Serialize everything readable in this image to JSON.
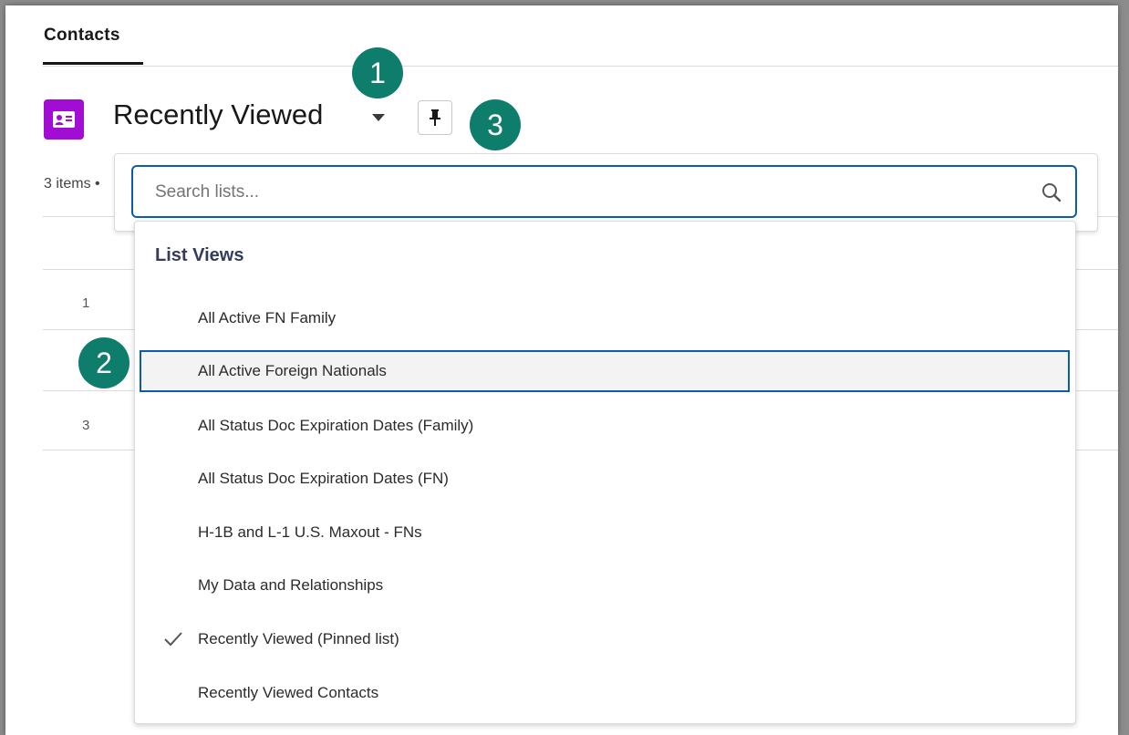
{
  "tab": {
    "title": "Contacts"
  },
  "header": {
    "list_title": "Recently Viewed",
    "object_icon": "contact-card-icon",
    "caret_icon": "caret-down-icon",
    "pin_icon": "pin-icon"
  },
  "list": {
    "items_count": "3 items •",
    "row_numbers": [
      "1",
      "3"
    ]
  },
  "callouts": [
    "1",
    "2",
    "3"
  ],
  "search": {
    "placeholder": "Search lists...",
    "icon": "search-icon"
  },
  "dropdown": {
    "header": "List Views",
    "items": [
      {
        "label": "All Active FN Family",
        "checked": false,
        "highlighted": false
      },
      {
        "label": "All Active Foreign Nationals",
        "checked": false,
        "highlighted": true
      },
      {
        "label": "All Status Doc Expiration Dates (Family)",
        "checked": false,
        "highlighted": false
      },
      {
        "label": "All Status Doc Expiration Dates (FN)",
        "checked": false,
        "highlighted": false
      },
      {
        "label": "H-1B and L-1 U.S. Maxout - FNs",
        "checked": false,
        "highlighted": false
      },
      {
        "label": "My Data and Relationships",
        "checked": false,
        "highlighted": false
      },
      {
        "label": "Recently Viewed (Pinned list)",
        "checked": true,
        "highlighted": false
      },
      {
        "label": "Recently Viewed Contacts",
        "checked": false,
        "highlighted": false
      }
    ]
  },
  "colors": {
    "accent_blue": "#0b5cab",
    "callout_teal": "#0f7d6c",
    "object_purple": "#a20dd3"
  }
}
